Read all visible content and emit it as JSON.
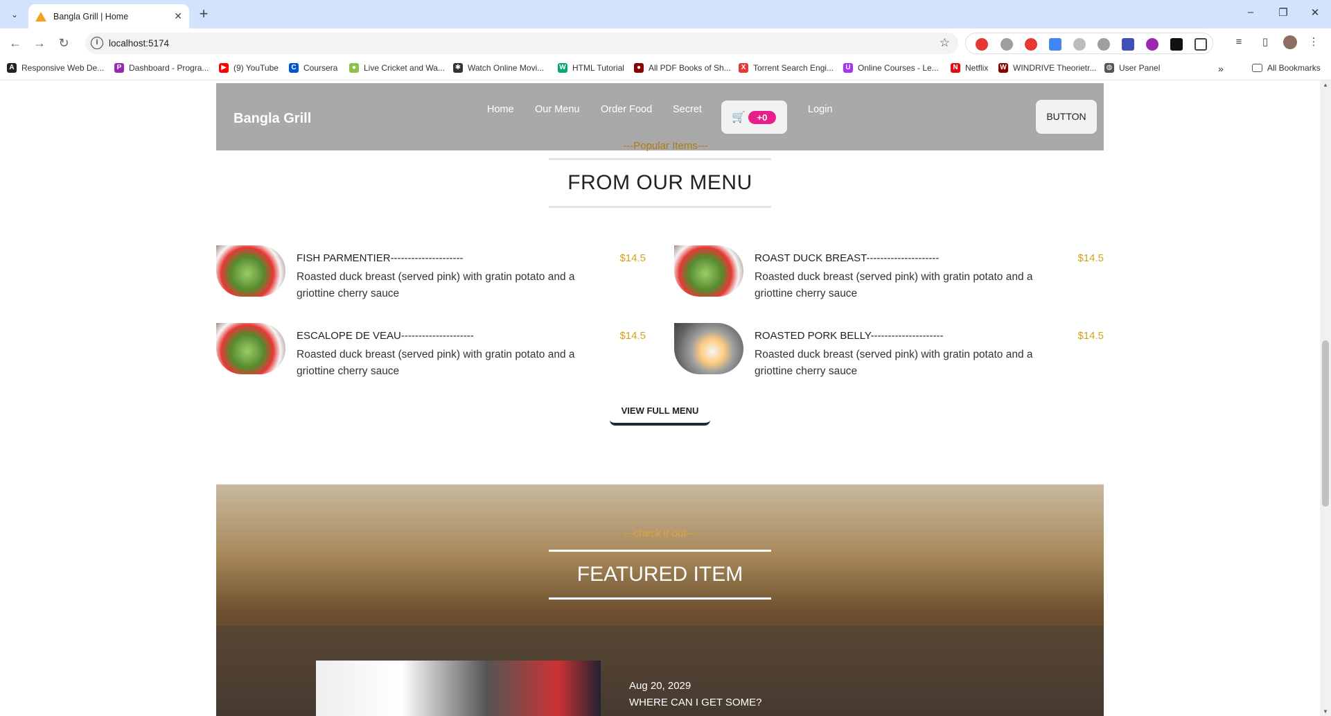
{
  "browser": {
    "tab_title": "Bangla Grill | Home",
    "url": "localhost:5174",
    "bookmarks": [
      {
        "label": "Responsive Web De...",
        "color": "#222222",
        "glyph": "A"
      },
      {
        "label": "Dashboard - Progra...",
        "color": "#9c27b0",
        "glyph": "P"
      },
      {
        "label": "(9) YouTube",
        "color": "#ff0000",
        "glyph": "▶"
      },
      {
        "label": "Coursera",
        "color": "#0056d2",
        "glyph": "C"
      },
      {
        "label": "Live Cricket and Wa...",
        "color": "#8bc34a",
        "glyph": "●"
      },
      {
        "label": "Watch Online Movi...",
        "color": "#333333",
        "glyph": "✱"
      },
      {
        "label": "HTML Tutorial",
        "color": "#04aa6d",
        "glyph": "W"
      },
      {
        "label": "All PDF Books of Sh...",
        "color": "#8b0000",
        "glyph": "●"
      },
      {
        "label": "Torrent Search Engi...",
        "color": "#e53935",
        "glyph": "X"
      },
      {
        "label": "Online Courses - Le...",
        "color": "#a435f0",
        "glyph": "U"
      },
      {
        "label": "Netflix",
        "color": "#e50914",
        "glyph": "N"
      },
      {
        "label": "WINDRIVE Theorietr...",
        "color": "#8b0000",
        "glyph": "W"
      },
      {
        "label": "User Panel",
        "color": "#555555",
        "glyph": "◍"
      }
    ],
    "all_bookmarks": "All Bookmarks"
  },
  "site": {
    "brand": "Bangla Grill",
    "nav": [
      "Home",
      "Our Menu",
      "Order Food",
      "Secret"
    ],
    "cart_count": "+0",
    "login": "Login",
    "button": "BUTTON"
  },
  "menu_section": {
    "subtitle": "---Popular Items---",
    "title": "FROM OUR MENU",
    "items": [
      {
        "name": "FISH PARMENTIER---------------------",
        "price": "$14.5",
        "desc": "Roasted duck breast (served pink) with gratin potato and a griottine cherry sauce"
      },
      {
        "name": "ROAST DUCK BREAST---------------------",
        "price": "$14.5",
        "desc": "Roasted duck breast (served pink) with gratin potato and a griottine cherry sauce"
      },
      {
        "name": "ESCALOPE DE VEAU---------------------",
        "price": "$14.5",
        "desc": "Roasted duck breast (served pink) with gratin potato and a griottine cherry sauce"
      },
      {
        "name": "ROASTED PORK BELLY---------------------",
        "price": "$14.5",
        "desc": "Roasted duck breast (served pink) with gratin potato and a griottine cherry sauce"
      }
    ],
    "view_full": "VIEW FULL MENU"
  },
  "featured": {
    "subtitle": "---check it out---",
    "title": "FEATURED ITEM",
    "date": "Aug 20, 2029",
    "question": "WHERE CAN I GET SOME?"
  }
}
